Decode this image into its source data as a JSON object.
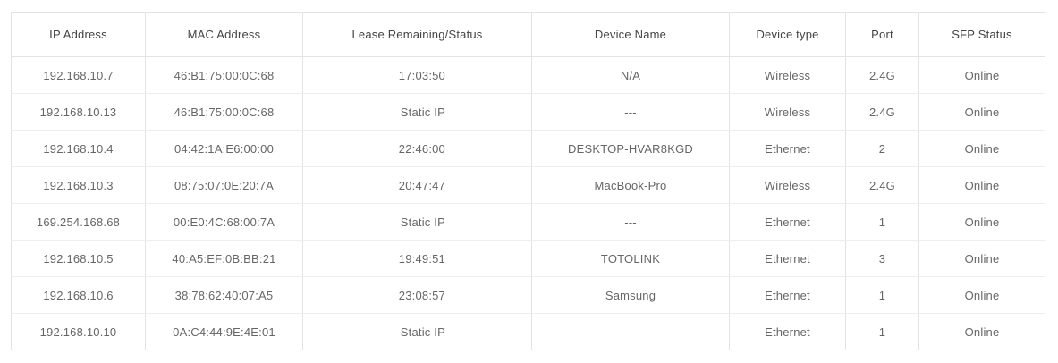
{
  "table": {
    "headers": {
      "ip": "IP Address",
      "mac": "MAC Address",
      "lease": "Lease Remaining/Status",
      "device": "Device Name",
      "type": "Device type",
      "port": "Port",
      "sfp": "SFP Status"
    },
    "rows": [
      {
        "ip": "192.168.10.7",
        "mac": "46:B1:75:00:0C:68",
        "lease": "17:03:50",
        "device": "N/A",
        "type": "Wireless",
        "port": "2.4G",
        "sfp": "Online"
      },
      {
        "ip": "192.168.10.13",
        "mac": "46:B1:75:00:0C:68",
        "lease": "Static IP",
        "device": "---",
        "type": "Wireless",
        "port": "2.4G",
        "sfp": "Online"
      },
      {
        "ip": "192.168.10.4",
        "mac": "04:42:1A:E6:00:00",
        "lease": "22:46:00",
        "device": "DESKTOP-HVAR8KGD",
        "type": "Ethernet",
        "port": "2",
        "sfp": "Online"
      },
      {
        "ip": "192.168.10.3",
        "mac": "08:75:07:0E:20:7A",
        "lease": "20:47:47",
        "device": "MacBook-Pro",
        "type": "Wireless",
        "port": "2.4G",
        "sfp": "Online"
      },
      {
        "ip": "169.254.168.68",
        "mac": "00:E0:4C:68:00:7A",
        "lease": "Static IP",
        "device": "---",
        "type": "Ethernet",
        "port": "1",
        "sfp": "Online"
      },
      {
        "ip": "192.168.10.5",
        "mac": "40:A5:EF:0B:BB:21",
        "lease": "19:49:51",
        "device": "TOTOLINK",
        "type": "Ethernet",
        "port": "3",
        "sfp": "Online"
      },
      {
        "ip": "192.168.10.6",
        "mac": "38:78:62:40:07:A5",
        "lease": "23:08:57",
        "device": "Samsung",
        "type": "Ethernet",
        "port": "1",
        "sfp": "Online"
      },
      {
        "ip": "192.168.10.10",
        "mac": "0A:C4:44:9E:4E:01",
        "lease": "Static IP",
        "device": "",
        "type": "Ethernet",
        "port": "1",
        "sfp": "Online"
      }
    ]
  }
}
